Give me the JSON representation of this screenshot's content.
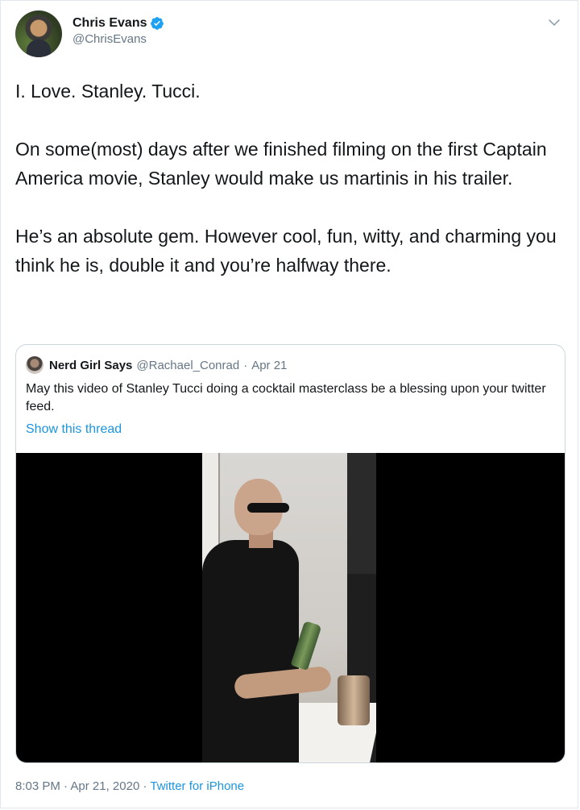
{
  "author": {
    "display_name": "Chris Evans",
    "handle": "@ChrisEvans",
    "verified": true
  },
  "tweet": {
    "paragraphs": [
      "I. Love. Stanley. Tucci.",
      "On some(most) days after we finished filming on the first Captain America movie, Stanley would make us martinis in his trailer.",
      "He’s an absolute gem. However cool, fun, witty, and charming you think he is, double it and you’re halfway there."
    ]
  },
  "quoted_tweet": {
    "display_name": "Nerd Girl Says",
    "handle": "@Rachael_Conrad",
    "separator": "·",
    "date": "Apr 21",
    "text": "May this video of Stanley Tucci doing a cocktail masterclass be a blessing upon your twitter feed.",
    "show_thread_label": "Show this thread"
  },
  "footer": {
    "time": "8:03 PM",
    "separator": "·",
    "date": "Apr 21, 2020",
    "source": "Twitter for iPhone"
  },
  "colors": {
    "link": "#1b95e0",
    "secondary_text": "#657786",
    "verified_badge": "#1da1f2"
  },
  "icons": {
    "verified": "verified-badge-icon",
    "menu": "chevron-down-icon"
  }
}
